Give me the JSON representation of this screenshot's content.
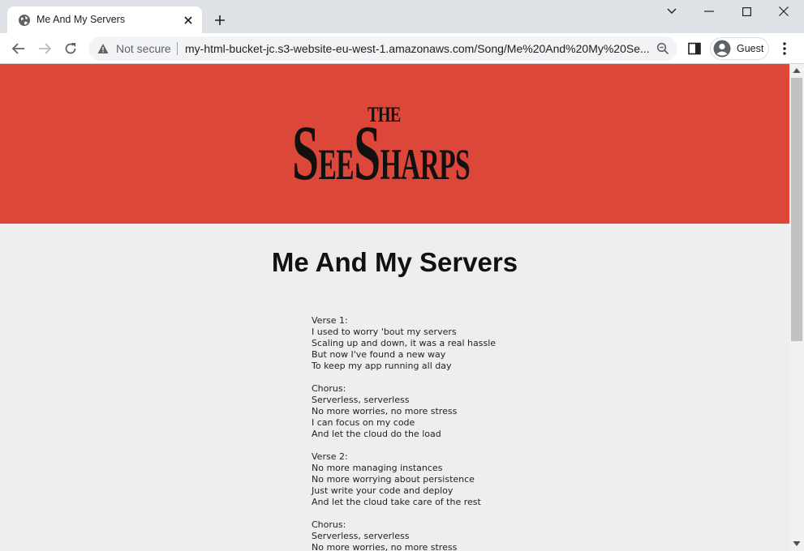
{
  "browser": {
    "tab_title": "Me And My Servers",
    "security_label": "Not secure",
    "url": "my-html-bucket-jc.s3-website-eu-west-1.amazonaws.com/Song/Me%20And%20My%20Se...",
    "profile_label": "Guest"
  },
  "logo": {
    "the": "THE",
    "see_big": "S",
    "see_small": "EE",
    "sharps_big": "S",
    "sharps_small": "HARPS"
  },
  "page": {
    "title": "Me And My Servers",
    "lyrics": "Verse 1:\nI used to worry 'bout my servers\nScaling up and down, it was a real hassle\nBut now I've found a new way\nTo keep my app running all day\n\nChorus:\nServerless, serverless\nNo more worries, no more stress\nI can focus on my code\nAnd let the cloud do the load\n\nVerse 2:\nNo more managing instances\nNo more worrying about persistence\nJust write your code and deploy\nAnd let the cloud take care of the rest\n\nChorus:\nServerless, serverless\nNo more worries, no more stress"
  },
  "colors": {
    "hero_background": "#dc473a",
    "page_background": "#eeeeee"
  }
}
